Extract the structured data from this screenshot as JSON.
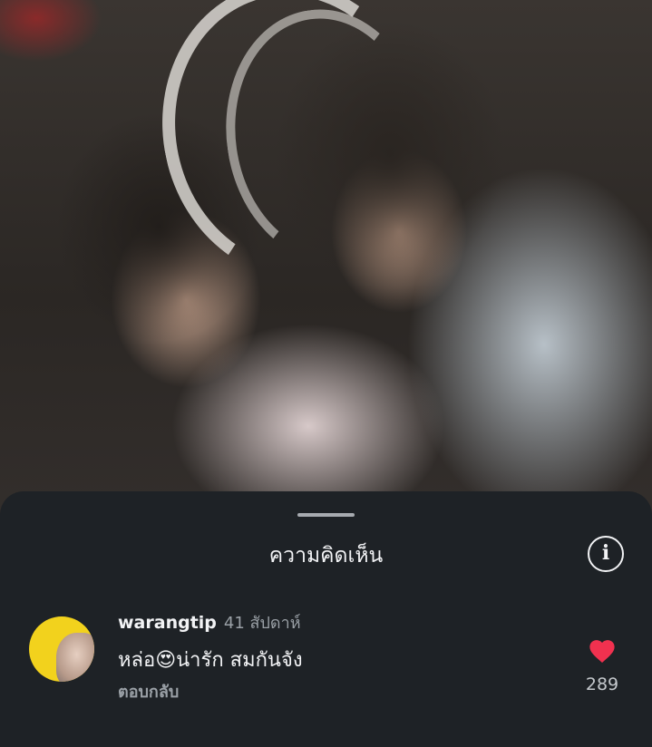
{
  "background": {
    "description_icon": "photo-two-people"
  },
  "sheet": {
    "title": "ความคิดเห็น",
    "info_icon": "info-icon",
    "info_glyph": "i"
  },
  "comments": [
    {
      "username": "warangtip",
      "time": "41 สัปดาห์",
      "text": "หล่อ😍น่ารัก สมกันจัง",
      "reply_label": "ตอบกลับ",
      "like_icon": "heart-filled-icon",
      "like_count": "289",
      "like_color": "#f0314f"
    }
  ],
  "colors": {
    "sheet_bg": "#1e2226",
    "accent_heart": "#f0314f",
    "avatar_bg": "#f2d21d"
  }
}
